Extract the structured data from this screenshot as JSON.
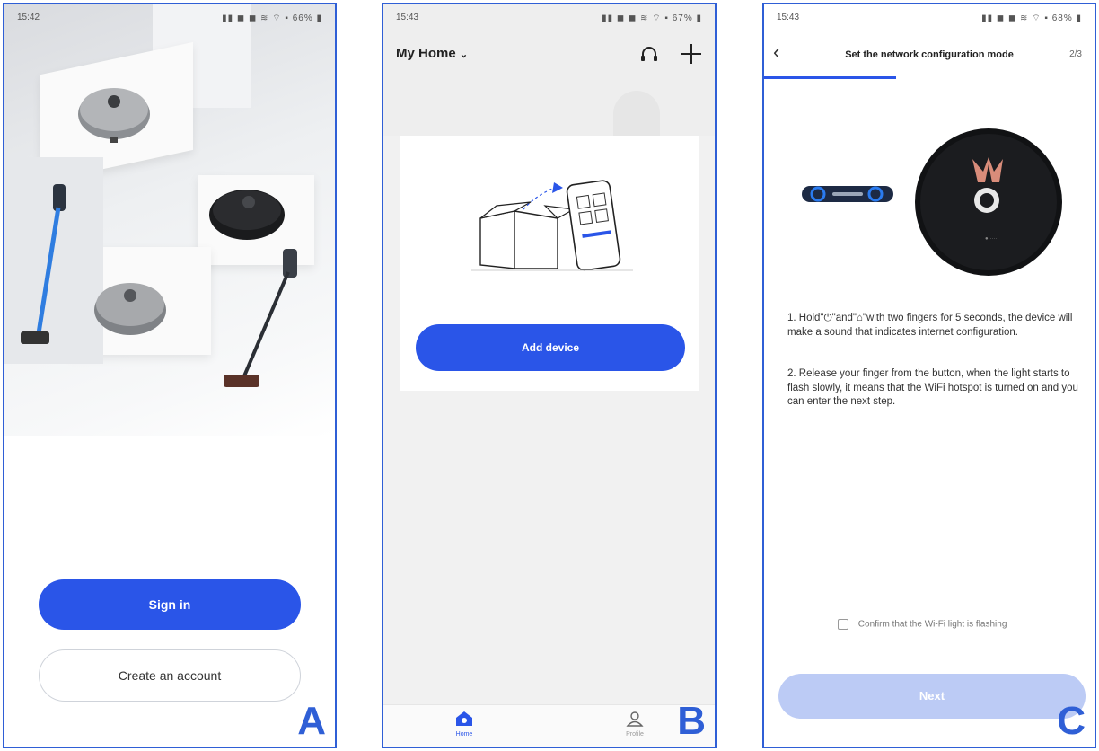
{
  "screens": {
    "a": {
      "letter": "A",
      "status_time": "15:42",
      "status_icons": "▮▮ ◼ ◼ ≋ ⌔ ▪ 66% ▮",
      "signin_label": "Sign in",
      "create_label": "Create an account"
    },
    "b": {
      "letter": "B",
      "status_time": "15:43",
      "status_icons": "▮▮ ◼ ◼ ≋ ⌔ ▪ 67% ▮",
      "home_title": "My Home",
      "add_device_label": "Add device",
      "tabs": [
        {
          "label": "Home",
          "icon": "home-icon",
          "active": true
        },
        {
          "label": "Profile",
          "icon": "profile-icon",
          "active": false
        }
      ]
    },
    "c": {
      "letter": "C",
      "status_time": "15:43",
      "status_icons": "▮▮ ◼ ◼ ≋ ⌔ ▪ 68% ▮",
      "title": "Set the network configuration mode",
      "step": "2/3",
      "progress": 0.4,
      "instruction_1": "1. Hold\"⏻\"and\"⌂\"with two fingers for 5 seconds, the device will make a sound that indicates internet configuration.",
      "instruction_2": "2. Release your finger from the button, when the light starts to flash slowly, it means that the WiFi hotspot is turned on and you can enter the next step.",
      "confirm_label": "Confirm that the Wi-Fi light is flashing",
      "next_label": "Next"
    }
  },
  "colors": {
    "accent": "#2a55e8",
    "accent_disabled": "#bccbf5",
    "frame_border": "#2f5fd6"
  }
}
